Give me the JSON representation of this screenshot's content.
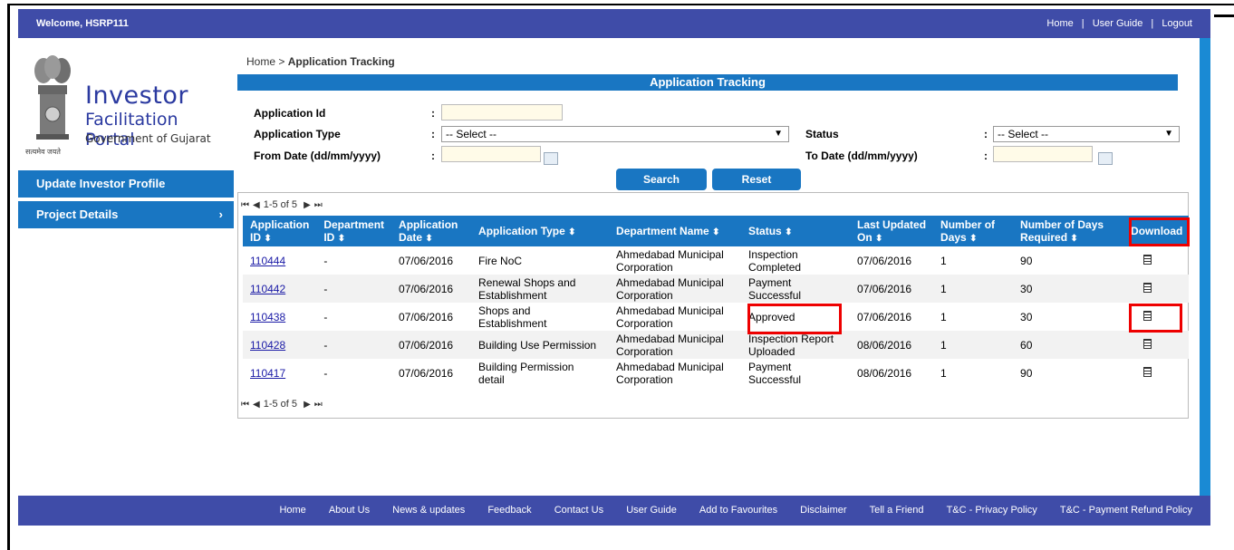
{
  "header": {
    "welcome": "Welcome,",
    "user": "HSRP111",
    "links": [
      "Home",
      "User Guide",
      "Logout"
    ],
    "separator": "|"
  },
  "logo": {
    "line1": "Investor",
    "line2": "Facilitation Portal",
    "line3": "Government of Gujarat",
    "motto": "सत्यमेव जयते"
  },
  "sidebar": {
    "items": [
      {
        "label": "Update Investor Profile"
      },
      {
        "label": "Project Details",
        "arrow": "›"
      }
    ]
  },
  "breadcrumb": {
    "home": "Home",
    "sep": " > ",
    "current": "Application Tracking"
  },
  "page_title": "Application Tracking",
  "form": {
    "app_id_label": "Application Id",
    "app_type_label": "Application Type",
    "app_type_value": "-- Select --",
    "status_label": "Status",
    "status_value": "-- Select --",
    "from_label": "From Date (dd/mm/yyyy)",
    "to_label": "To Date (dd/mm/yyyy)",
    "colon": ":",
    "search": "Search",
    "reset": "Reset"
  },
  "pager": {
    "text": "1-5 of 5"
  },
  "table": {
    "headers": [
      "Application ID",
      "Department ID",
      "Application Date",
      "Application Type",
      "Department Name",
      "Status",
      "Last Updated On",
      "Number of Days",
      "Number of Days Required",
      "Download"
    ],
    "rows": [
      {
        "id": "110444",
        "dept": "-",
        "date": "07/06/2016",
        "type": "Fire NoC",
        "dname": "Ahmedabad Municipal Corporation",
        "status": "Inspection Completed",
        "updated": "07/06/2016",
        "days": "1",
        "req": "90"
      },
      {
        "id": "110442",
        "dept": "-",
        "date": "07/06/2016",
        "type": "Renewal Shops and Establishment",
        "dname": "Ahmedabad Municipal Corporation",
        "status": "Payment Successful",
        "updated": "07/06/2016",
        "days": "1",
        "req": "30"
      },
      {
        "id": "110438",
        "dept": "-",
        "date": "07/06/2016",
        "type": "Shops and Establishment",
        "dname": "Ahmedabad Municipal Corporation",
        "status": "Approved",
        "updated": "07/06/2016",
        "days": "1",
        "req": "30"
      },
      {
        "id": "110428",
        "dept": "-",
        "date": "07/06/2016",
        "type": "Building Use Permission",
        "dname": "Ahmedabad Municipal Corporation",
        "status": "Inspection Report Uploaded",
        "updated": "08/06/2016",
        "days": "1",
        "req": "60"
      },
      {
        "id": "110417",
        "dept": "-",
        "date": "07/06/2016",
        "type": "Building Permission detail",
        "dname": "Ahmedabad Municipal Corporation",
        "status": "Payment Successful",
        "updated": "08/06/2016",
        "days": "1",
        "req": "90"
      }
    ]
  },
  "footer": {
    "links": [
      "Home",
      "About Us",
      "News & updates",
      "Feedback",
      "Contact Us",
      "User Guide",
      "Add to Favourites",
      "Disclaimer",
      "Tell a Friend",
      "T&C - Privacy Policy",
      "T&C - Payment Refund Policy"
    ]
  },
  "colors": {
    "header_bg": "#3f4ca8",
    "accent": "#1976c2",
    "link": "#1a1aa6",
    "highlight": "#e00000"
  }
}
